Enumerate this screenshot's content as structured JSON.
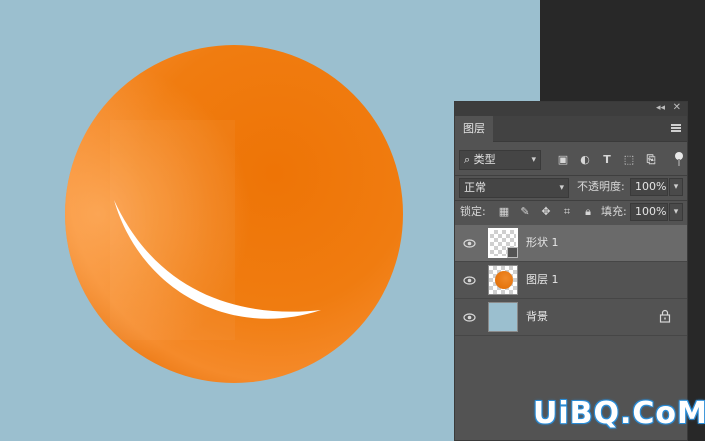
{
  "colors": {
    "canvas_bg": "#9bbfcf",
    "dark_bg": "#282828",
    "panel_bg": "#535353",
    "sphere": "#f07b10",
    "watermark_outline": "#2b8cd6"
  },
  "panel": {
    "tab": "图层",
    "filter": {
      "kind_label": "类型"
    },
    "blend": {
      "mode": "正常",
      "opacity_label": "不透明度:",
      "opacity_value": "100%"
    },
    "lock": {
      "lock_label": "锁定:",
      "fill_label": "填充:",
      "fill_value": "100%"
    },
    "layers": [
      {
        "name": "形状 1",
        "type": "shape",
        "selected": true
      },
      {
        "name": "图层 1",
        "type": "pixel",
        "selected": false
      },
      {
        "name": "背景",
        "type": "background",
        "locked": true,
        "selected": false
      }
    ]
  },
  "watermark": "UiBQ.CoM"
}
